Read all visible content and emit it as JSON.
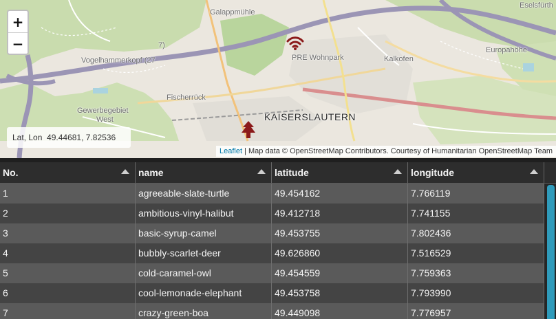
{
  "map": {
    "zoom_in_label": "+",
    "zoom_out_label": "−",
    "coords_label": "Lat, Lon",
    "coords_value": "49.44681, 7.82536",
    "attribution_link": "Leaflet",
    "attribution_text": " | Map data © OpenStreetMap Contributors. Courtesy of Humanitarian OpenStreetMap Team",
    "labels": {
      "galappmuehle": "Galappmühle",
      "eselsfuerth": "Eselsfürth",
      "vogelhammerkopf": "Vogelhammerkopf (27",
      "road_7": "7)",
      "pre_wohnpark": "PRE Wohnpark",
      "kalkofen": "Kalkofen",
      "europahoehe": "Europahöhe",
      "fischerrueck": "Fischerrück",
      "gewerbegebiet": "Gewerbegebiet",
      "west": "West",
      "kaiserslautern": "KAISERSLAUTERN"
    },
    "marker_color": "#8b1a1a"
  },
  "table": {
    "headers": [
      "No.",
      "name",
      "latitude",
      "longitude"
    ],
    "rows": [
      [
        "1",
        "agreeable-slate-turtle",
        "49.454162",
        "7.766119"
      ],
      [
        "2",
        "ambitious-vinyl-halibut",
        "49.412718",
        "7.741155"
      ],
      [
        "3",
        "basic-syrup-camel",
        "49.453755",
        "7.802436"
      ],
      [
        "4",
        "bubbly-scarlet-deer",
        "49.626860",
        "7.516529"
      ],
      [
        "5",
        "cold-caramel-owl",
        "49.454559",
        "7.759363"
      ],
      [
        "6",
        "cool-lemonade-elephant",
        "49.453758",
        "7.793990"
      ],
      [
        "7",
        "crazy-green-boa",
        "49.449098",
        "7.776957"
      ]
    ]
  },
  "colors": {
    "scroll_accent": "#2f9bbb",
    "row_odd": "#5a5a5a",
    "row_even": "#444444"
  }
}
